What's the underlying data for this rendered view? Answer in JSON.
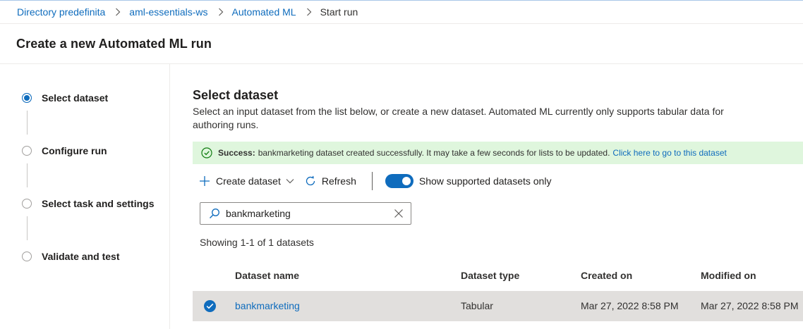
{
  "breadcrumb": {
    "items": [
      "Directory predefinita",
      "aml-essentials-ws",
      "Automated ML"
    ],
    "current": "Start run"
  },
  "header": {
    "title": "Create a new Automated ML run"
  },
  "steps": [
    {
      "label": "Select dataset",
      "active": true
    },
    {
      "label": "Configure run",
      "active": false
    },
    {
      "label": "Select task and settings",
      "active": false
    },
    {
      "label": "Validate and test",
      "active": false
    }
  ],
  "main": {
    "title": "Select dataset",
    "description": "Select an input dataset from the list below, or create a new dataset. Automated ML currently only supports tabular data for authoring runs.",
    "banner": {
      "prefix": "Success:",
      "message": "bankmarketing dataset created successfully. It may take a few seconds for lists to be updated.",
      "link": "Click here to go to this dataset"
    },
    "toolbar": {
      "create_label": "Create dataset",
      "refresh_label": "Refresh",
      "toggle_label": "Show supported datasets only",
      "toggle_on": true
    },
    "search": {
      "value": "bankmarketing"
    },
    "showing": "Showing 1-1 of 1 datasets",
    "table": {
      "columns": [
        "Dataset name",
        "Dataset type",
        "Created on",
        "Modified on"
      ],
      "rows": [
        {
          "name": "bankmarketing",
          "type": "Tabular",
          "created": "Mar 27, 2022 8:58 PM",
          "modified": "Mar 27, 2022 8:58 PM",
          "selected": true
        }
      ]
    }
  },
  "colors": {
    "accent": "#0f6cbd",
    "success_bg": "#dff6dd",
    "success_icon": "#107c10",
    "selected_row": "#e1dfdd"
  }
}
